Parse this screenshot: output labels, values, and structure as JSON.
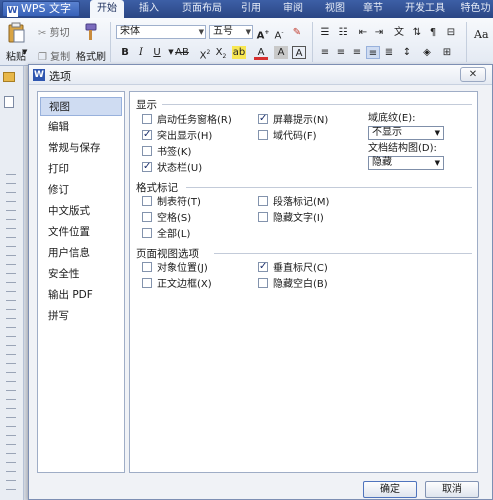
{
  "app": {
    "title": "WPS 文字"
  },
  "menu": [
    "开始",
    "插入",
    "页面布局",
    "引用",
    "审阅",
    "视图",
    "章节",
    "开发工具",
    "特色功"
  ],
  "ribbon": {
    "paste": "粘贴",
    "cut": "剪切",
    "copy": "复制",
    "format_painter": "格式刷",
    "font_name": "宋体",
    "font_size": "五号",
    "right_edge": "Aa"
  },
  "dialog": {
    "title": "选项",
    "close": "✕",
    "nav": [
      "视图",
      "编辑",
      "常规与保存",
      "打印",
      "修订",
      "中文版式",
      "文件位置",
      "用户信息",
      "安全性",
      "输出 PDF",
      "拼写"
    ],
    "groups": {
      "display": {
        "title": "显示",
        "options": [
          {
            "label": "启动任务窗格(R)",
            "checked": false
          },
          {
            "label": "屏幕提示(N)",
            "checked": true
          },
          {
            "label": "突出显示(H)",
            "checked": true
          },
          {
            "label": "域代码(F)",
            "checked": false
          },
          {
            "label": "书签(K)",
            "checked": false
          },
          {
            "label": "状态栏(U)",
            "checked": true
          }
        ],
        "field_shading_label": "域底纹(E):",
        "field_shading_value": "不显示",
        "doc_map_label": "文档结构图(D):",
        "doc_map_value": "隐藏"
      },
      "format_marks": {
        "title": "格式标记",
        "options": [
          {
            "label": "制表符(T)",
            "checked": false
          },
          {
            "label": "段落标记(M)",
            "checked": false
          },
          {
            "label": "空格(S)",
            "checked": false
          },
          {
            "label": "隐藏文字(I)",
            "checked": false
          },
          {
            "label": "全部(L)",
            "checked": false
          }
        ]
      },
      "page_view": {
        "title": "页面视图选项",
        "options": [
          {
            "label": "对象位置(J)",
            "checked": false
          },
          {
            "label": "垂直标尺(C)",
            "checked": true
          },
          {
            "label": "正文边框(X)",
            "checked": false
          },
          {
            "label": "隐藏空白(B)",
            "checked": false
          }
        ]
      }
    },
    "ok": "确定",
    "cancel": "取消"
  },
  "watermark": "Baidu经验"
}
